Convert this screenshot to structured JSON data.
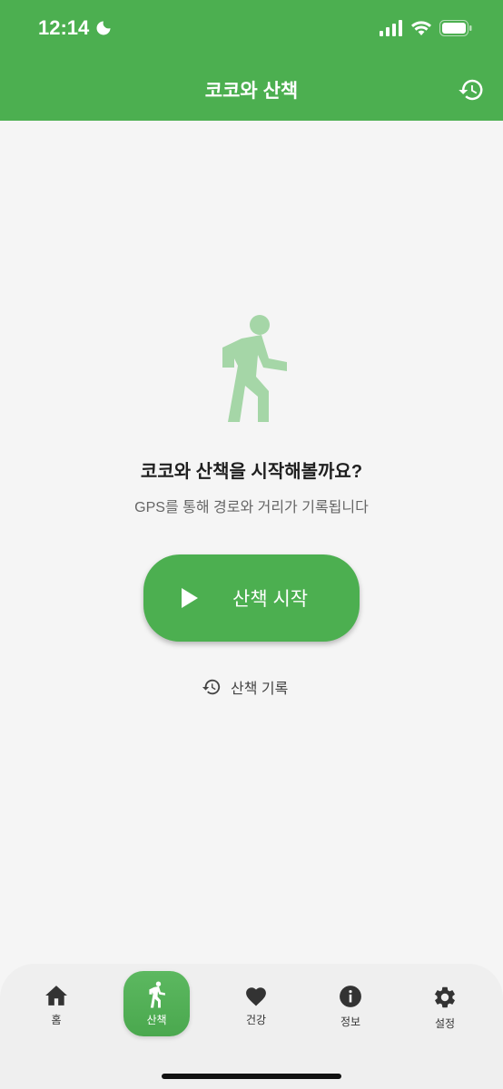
{
  "status_bar": {
    "time": "12:14"
  },
  "app_bar": {
    "title": "코코와 산책"
  },
  "main": {
    "prompt": "코코와 산책을 시작해볼까요?",
    "subtitle": "GPS를 통해 경로와 거리가 기록됩니다",
    "start_button_label": "산책 시작",
    "record_link_label": "산책 기록"
  },
  "bottom_nav": {
    "items": [
      {
        "label": "홈",
        "icon": "home-icon"
      },
      {
        "label": "산책",
        "icon": "walk-icon",
        "active": true
      },
      {
        "label": "건강",
        "icon": "heart-icon"
      },
      {
        "label": "정보",
        "icon": "info-icon"
      },
      {
        "label": "설정",
        "icon": "gear-icon"
      }
    ]
  },
  "colors": {
    "primary": "#4caf50",
    "background": "#f5f5f5",
    "walker_icon": "#a5d6a7",
    "nav_background": "#efefef"
  }
}
